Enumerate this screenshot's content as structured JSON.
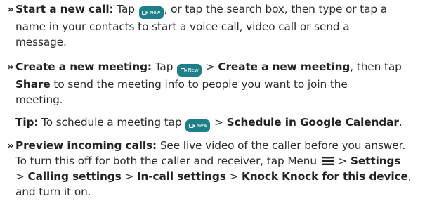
{
  "colors": {
    "text": "#2b2b2b",
    "button_bg": "#1f7f88",
    "button_text": "#ffffff"
  },
  "bullet_glyph": "»",
  "new_button_label": "New",
  "p1": {
    "title": "Start a new call:",
    "l1_a": "Tap",
    "l1_b": ", or tap the search box, then type or tap a",
    "l2": "name in your contacts to start a voice call, video call or send a",
    "l3": "message."
  },
  "p2": {
    "title": "Create a new meeting:",
    "l1_a": "Tap",
    "l1_b": ">",
    "l1_c": "Create a new meeting",
    "l1_d": ", then tap",
    "l2_a": "Share",
    "l2_b": "to send the meeting info to people you want to join the",
    "l3": "meeting."
  },
  "tip": {
    "title": "Tip:",
    "a": "To schedule a meeting tap",
    "b": ">",
    "c": "Schedule in Google Calendar",
    "d": "."
  },
  "p3": {
    "title": "Preview incoming calls:",
    "l1_a": "See live video of the caller before you answer.",
    "l2_a": "To turn this off for both the caller and receiver, tap Menu",
    "l2_b": ">",
    "l2_c": "Settings",
    "l3_a": ">",
    "l3_b": "Calling settings",
    "l3_c": ">",
    "l3_d": "In-call settings",
    "l3_e": ">",
    "l3_f": "Knock Knock for this device",
    "l3_g": ",",
    "l4": "and turn it on."
  }
}
